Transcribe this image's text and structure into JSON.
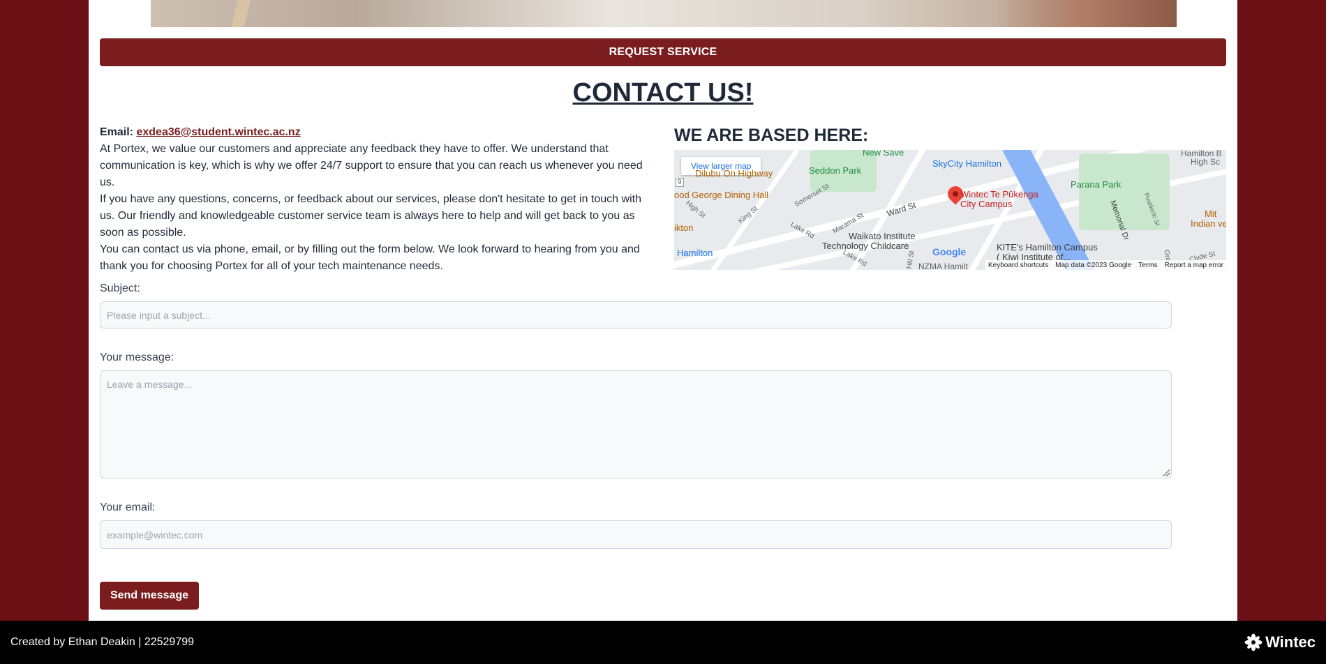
{
  "header": {
    "request_service_label": "REQUEST SERVICE"
  },
  "contact": {
    "title": "CONTACT US!",
    "email_label": "Email:",
    "email_address": "exdea36@student.wintec.ac.nz",
    "paragraphs": [
      "At Portex, we value our customers and appreciate any feedback they have to offer. We understand that communication is key, which is why we offer 24/7 support to ensure that you can reach us whenever you need us.",
      "If you have any questions, concerns, or feedback about our services, please don't hesitate to get in touch with us. Our friendly and knowledgeable customer service team is always here to help and will get back to you as soon as possible.",
      "You can contact us via phone, email, or by filling out the form below. We look forward to hearing from you and thank you for choosing Portex for all of your tech maintenance needs."
    ]
  },
  "map": {
    "title": "WE ARE BASED HERE:",
    "larger_map_label": "View larger map",
    "pin_label_line1": "Wintec Te Pūkenga",
    "pin_label_line2": "City Campus",
    "places": {
      "new_save": "New Save",
      "seddon_park": "Seddon Park",
      "skycity": "SkyCity Hamilton",
      "parana_park": "Parana Park",
      "hamilton_b": "Hamilton B",
      "high_sc": "High Sc",
      "dining_hall": "ood George Dining Hall",
      "highway": "Dilubu On Highway",
      "waikato_line1": "Waikato Institute",
      "waikato_line2": "Technology Childcare",
      "kite_line1": "KITE's Hamilton Campus",
      "kite_line2": "( Kiwi Institute of...",
      "hamilton": "Hamilton",
      "indian": "Indian veg",
      "mit": "Mit",
      "ikton": "ikton",
      "nzma": "NZMA Hamilt"
    },
    "streets": {
      "ward_st": "Ward St",
      "high_st": "High St",
      "king_st": "King St",
      "lake_rd": "Lake Rd",
      "lake_rd_2": "Lake Rd",
      "marama_st": "Marama St",
      "somerset_st": "Somerset St",
      "memorial_dr": "Memorial Dr",
      "puutikiriki_st": "Puutikiriki St",
      "clyde_st": "Clyde St",
      "hill_st": "Hill St",
      "gre": "Gre",
      "road_9": "9"
    },
    "google_logo": "Google",
    "footer_items": [
      "Keyboard shortcuts",
      "Map data ©2023 Google",
      "Terms",
      "Report a map error"
    ],
    "colors": {
      "pin": "#ea4335",
      "park": "#c9e7cd",
      "river": "#8ab4f8",
      "link": "#1a73e8"
    }
  },
  "form": {
    "subject_label": "Subject:",
    "subject_placeholder": "Please input a subject...",
    "message_label": "Your message:",
    "message_placeholder": "Leave a message...",
    "email_label": "Your email:",
    "email_placeholder": "example@wintec.com",
    "send_label": "Send message"
  },
  "footer": {
    "credit": "Created by Ethan Deakin | 22529799",
    "brand": "Wintec",
    "brand_icon": "wintec-flower-icon"
  },
  "colors": {
    "primary": "#7b1d1f",
    "background": "#6b1014",
    "footer": "#000000"
  }
}
